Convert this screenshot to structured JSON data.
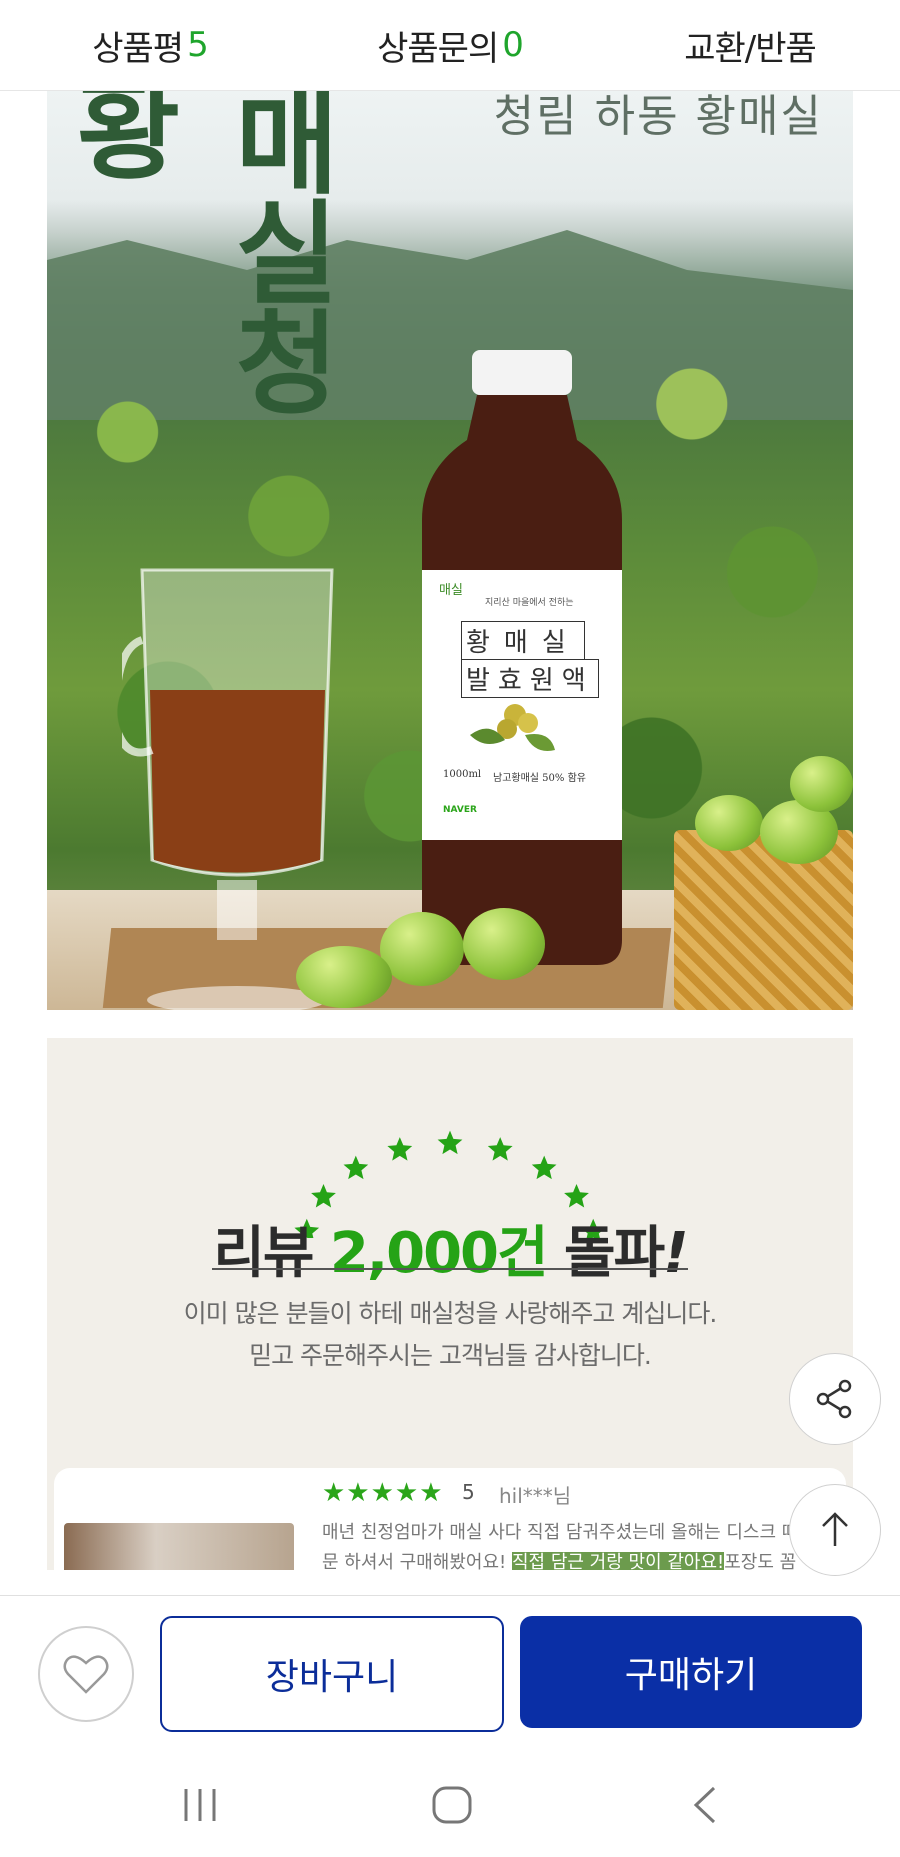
{
  "tabs": [
    {
      "label": "상품평",
      "count": "5"
    },
    {
      "label": "상품문의",
      "count": "0"
    },
    {
      "label": "교환/반품",
      "count": ""
    }
  ],
  "product_image": {
    "title_chars_vertical": [
      "매",
      "실",
      "청"
    ],
    "title_left_char": "황",
    "top_subtitle": "청림 하동 황매실",
    "bottle_label": {
      "brand": "매실",
      "tagline": "지리산 마을에서 전하는",
      "name_line1": "황매실",
      "name_line2": "발효원액",
      "volume": "1000ml",
      "content": "남고황매실 50% 함유",
      "naver": "NAVER"
    }
  },
  "review_banner": {
    "prefix": "리뷰",
    "highlight": "2,000건",
    "suffix": "돌파",
    "exclaim": "!",
    "line1": "이미 많은 분들이 하테 매실청을 사랑해주고 계십니다.",
    "line2": "믿고 주문해주시는 고객님들 감사합니다."
  },
  "review_card": {
    "stars": "★★★★★",
    "score": "5",
    "user": "hil***님",
    "text_line1": "매년 친정엄마가 매실 사다 직접 담궈주셨는데 올해는 디스크 때",
    "text_line2_pre": "문 하셔서 구매해봤어요! ",
    "text_line2_highlight": "직접 담근 거랑 맛이 같아요!",
    "text_line2_post": "포장도 꼼"
  },
  "bottom_bar": {
    "cart_label": "장바구니",
    "buy_label": "구매하기"
  },
  "icons": {
    "heart": "heart-icon",
    "share": "share-icon",
    "arrow_up": "arrow-up-icon",
    "recents": "recents-icon",
    "home": "home-icon",
    "back": "back-icon"
  },
  "colors": {
    "accent_green": "#1fa52c",
    "brand_blue": "#0a2fa6",
    "panel_bg": "#f2efe9"
  }
}
